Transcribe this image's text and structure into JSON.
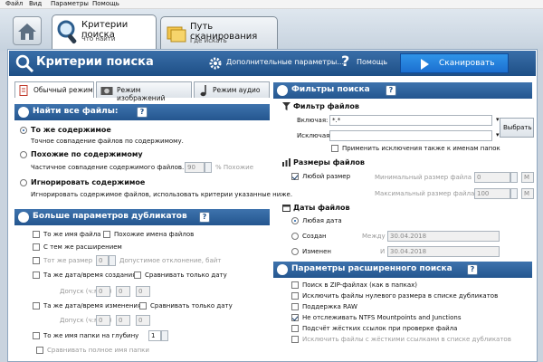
{
  "menu": [
    "Файл",
    "Вид",
    "Параметры",
    "Помощь"
  ],
  "tabs": [
    {
      "title": "Критерии поиска",
      "subtitle": "Что найти"
    },
    {
      "title": "Путь сканирования",
      "subtitle": "Где искать"
    }
  ],
  "header": {
    "title": "Критерии поиска",
    "advanced": "Дополнительные параметры...",
    "help": "Помощь",
    "run": "Сканировать",
    "q": "?"
  },
  "search_tabs": [
    "Обычный режим",
    "Режим изображений",
    "Режим аудио"
  ],
  "find_all": {
    "title": "Найти все файлы:",
    "same_content": "То же содержимое",
    "same_content_desc": "Точное совпадение файлов по содержимому.",
    "similar": "Похожие по содержимому",
    "similar_desc": "Частичное совпадение содержимого файлов.",
    "similar_value": "90",
    "similar_unit": "% Похожие",
    "ignore": "Игнорировать содержимое",
    "ignore_desc": "Игнорировать содержимое файлов, использовать критерии указанные ниже."
  },
  "more": {
    "title": "Больше параметров дубликатов",
    "same_name": "То же имя файла",
    "similar_names": "Похожие имена файлов",
    "same_ext": "С тем же расширением",
    "same_size": "Тот же размер",
    "size_value": "0",
    "deviation": "Допустимое отклонение, байт",
    "same_created": "Та же дата/время создания",
    "compare_date1": "Сравнивать только дату",
    "tolerance1": "Допуск (ч:мм:с)",
    "same_modified": "Та же дата/время изменения",
    "compare_date2": "Сравнивать только дату",
    "tolerance2": "Допуск (ч:мм:с)",
    "time_zero": "0",
    "same_folder": "То же имя папки на глубину",
    "depth": "1",
    "compare_full": "Сравнивать полное имя папки"
  },
  "filters": {
    "title": "Фильтры поиска",
    "file_filter": "Фильтр файлов",
    "include": "Включая:",
    "include_value": "*.*",
    "exclude": "Исключая:",
    "choose": "Выбрать",
    "apply_folders": "Применить исключения также к именам папок",
    "sizes": "Размеры файлов",
    "any_size": "Любой размер",
    "min_size": "Минимальный размер файла",
    "min_value": "0",
    "max_size": "Максимальный размер файла",
    "max_value": "100",
    "unit": "M",
    "dates": "Даты файлов",
    "any_date": "Любая дата",
    "created": "Создан",
    "between": "Между",
    "date1": "30.04.2018",
    "modified": "Изменен",
    "and": "И",
    "date2": "30.04.2018"
  },
  "advanced_opts": {
    "title": "Параметры расширенного поиска",
    "zip": "Поиск в ZIP-файлах (как в папках)",
    "zero": "Исключить файлы нулевого размера в списке дубликатов",
    "raw": "Поддержка RAW",
    "ntfs": "Не отслеживать NTFS Mountpoints and Junctions",
    "hardlinks": "Подсчёт жёстких ссылок при проверке файла",
    "hardlinks_excl": "Исключить файлы с жёсткими ссылками в списке дубликатов"
  }
}
